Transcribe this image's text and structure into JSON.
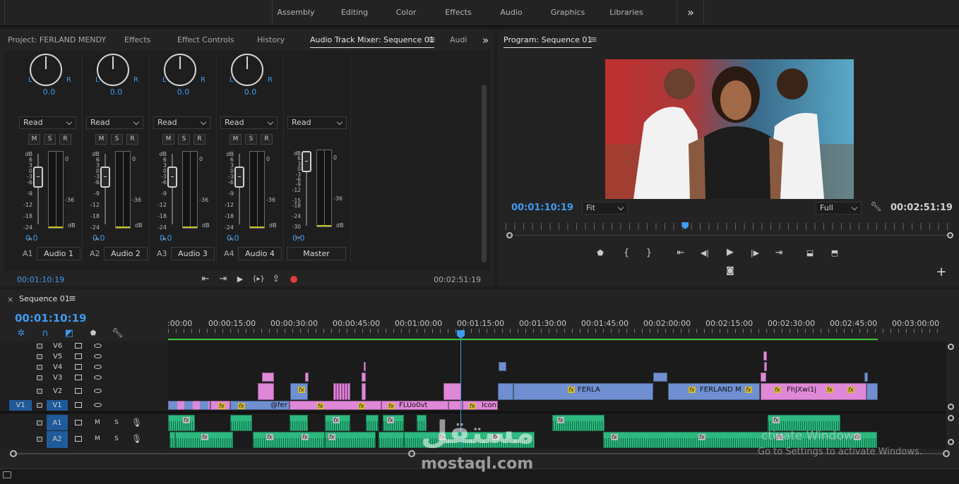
{
  "workspace": {
    "tabs": [
      "Assembly",
      "Editing",
      "Color",
      "Effects",
      "Audio",
      "Graphics",
      "Libraries"
    ],
    "more": "»"
  },
  "left_panel": {
    "tabs": [
      "Project: FERLAND MENDY",
      "Effects",
      "Effect Controls",
      "History",
      "Audio Track Mixer: Sequence 01",
      "Audi"
    ],
    "active_tab": "Audio Track Mixer: Sequence 01",
    "channels": [
      {
        "num": "A1",
        "name": "Audio 1",
        "pan": "0.0",
        "mode": "Read",
        "volume": "0.0"
      },
      {
        "num": "A2",
        "name": "Audio 2",
        "pan": "0.0",
        "mode": "Read",
        "volume": "0.0"
      },
      {
        "num": "A3",
        "name": "Audio 3",
        "pan": "0.0",
        "mode": "Read",
        "volume": "0.0"
      },
      {
        "num": "A4",
        "name": "Audio 4",
        "pan": "0.0",
        "mode": "Read",
        "volume": "0.0"
      },
      {
        "num": "",
        "name": "Master",
        "pan": "",
        "mode": "Read",
        "volume": "0.0"
      }
    ],
    "msr": [
      "M",
      "S",
      "R"
    ],
    "pan_l": "L",
    "pan_r": "R",
    "fader_scale": [
      "dB",
      "6",
      "3",
      "0",
      "-3",
      "-6",
      "-9",
      "-12",
      "-18",
      "-24",
      "-∞"
    ],
    "master_scale": [
      "dB",
      "6",
      "3",
      "0",
      "-3",
      "-6",
      "-9",
      "-12",
      "-15",
      "-18",
      "-24",
      "-30",
      "-∞"
    ],
    "meter_scale": [
      "0",
      "-36",
      "dB"
    ],
    "timecode_current": "00:01:10:19",
    "timecode_end": "00:02:51:19"
  },
  "program": {
    "title": "Program: Sequence 01",
    "timecode_current": "00:01:10:19",
    "timecode_end": "00:02:51:19",
    "zoom": "Fit",
    "resolution": "Full",
    "playhead_fraction": 0.4
  },
  "timeline": {
    "title": "Sequence 01",
    "timecode": "00:01:10:19",
    "ruler": [
      ":00:00",
      "00:00:15:00",
      "00:00:30:00",
      "00:00:45:00",
      "00:01:00:00",
      "00:01:15:00",
      "00:01:30:00",
      "00:01:45:00",
      "00:02:00:00",
      "00:02:15:00",
      "00:02:30:00",
      "00:02:45:00",
      "00:03:00:00"
    ],
    "video_tracks": [
      "V6",
      "V5",
      "V4",
      "V3",
      "V2",
      "V1"
    ],
    "audio_tracks": [
      "A1",
      "A2"
    ],
    "source_patch": "V1",
    "clip_labels": {
      "v1a": "@fer",
      "v1b": "FLUo0vt",
      "v1c": "Icon",
      "v2a": "FERLA",
      "v2b": "FERLAND M",
      "v2c": "FhJXwi1j"
    },
    "fx": "fx",
    "m": "M",
    "s": "S"
  },
  "watermark": {
    "arabic": "مستقل",
    "latin": "mostaql.com"
  },
  "windows_activation": {
    "line1": "ctivate Windows",
    "line2": "Go to Settings to activate Windows."
  },
  "colors": {
    "accent": "#3d9bf0",
    "video_blue": "#6f8fd0",
    "video_pink": "#e088d8",
    "audio_green": "#2db87f",
    "green_bar": "#3cc83c",
    "record": "#e03a3a"
  }
}
